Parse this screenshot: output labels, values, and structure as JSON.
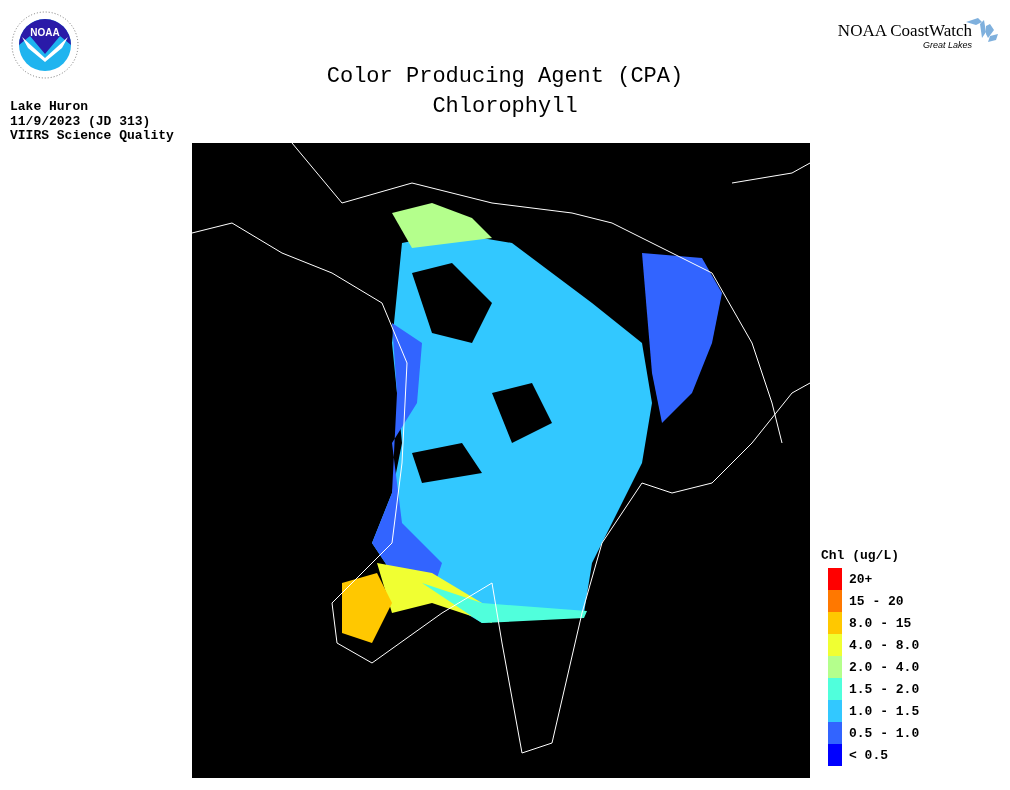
{
  "agency_logo": {
    "text": "NOAA"
  },
  "brand": {
    "name": "NOAA CoastWatch",
    "region": "Great Lakes"
  },
  "title": [
    "Color Producing Agent (CPA)",
    "Chlorophyll"
  ],
  "info": [
    "Lake Huron",
    "11/9/2023 (JD 313)",
    "VIIRS Science Quality"
  ],
  "legend": {
    "title": "Chl (ug/L)",
    "items": [
      {
        "label": "20+",
        "color": "#ff0000"
      },
      {
        "label": "15 - 20",
        "color": "#ff7800"
      },
      {
        "label": "8.0 - 15",
        "color": "#ffc800"
      },
      {
        "label": "4.0 - 8.0",
        "color": "#f0ff32"
      },
      {
        "label": "2.0 - 4.0",
        "color": "#b4ff8c"
      },
      {
        "label": "1.5 - 2.0",
        "color": "#50ffdc"
      },
      {
        "label": "1.0 - 1.5",
        "color": "#32c8ff"
      },
      {
        "label": "0.5 - 1.0",
        "color": "#3264ff"
      },
      {
        "label": "< 0.5",
        "color": "#0000ff"
      }
    ]
  }
}
